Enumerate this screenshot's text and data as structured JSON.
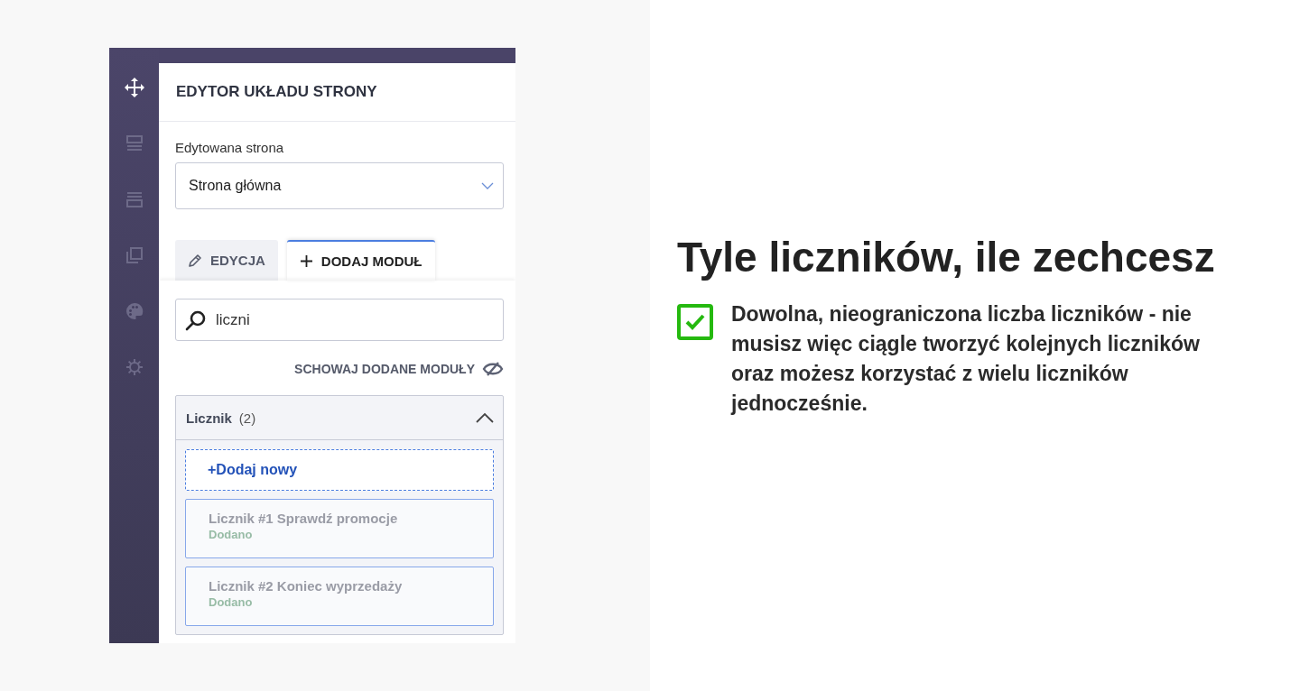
{
  "sidebar": {
    "items": [
      {
        "kind": "move",
        "selected": true
      },
      {
        "kind": "layout-top",
        "selected": false
      },
      {
        "kind": "layout-bottom",
        "selected": false
      },
      {
        "kind": "copy",
        "selected": false
      },
      {
        "kind": "palette",
        "selected": false
      },
      {
        "kind": "settings",
        "selected": false
      }
    ]
  },
  "panel": {
    "title": "EDYTOR UKŁADU STRONY",
    "page_label": "Edytowana strona",
    "page_select": {
      "value": "Strona główna"
    },
    "tabs": [
      {
        "kind": "pencil",
        "label": "EDYCJA",
        "selected": false
      },
      {
        "kind": "plus",
        "label": "DODAJ MODUŁ",
        "selected": true
      }
    ],
    "search": {
      "value": "liczni"
    },
    "hide_added": "SCHOWAJ DODANE MODUŁY",
    "group": {
      "title": "Licznik",
      "count": "(2)",
      "expanded": true,
      "items": [
        {
          "kind": "add",
          "label": "+Dodaj nowy"
        },
        {
          "kind": "module",
          "label": "Licznik #1 Sprawdź promocje",
          "status": "Dodano"
        },
        {
          "kind": "module",
          "label": "Licznik #2 Koniec wyprzedaży",
          "status": "Dodano"
        }
      ]
    }
  },
  "promo": {
    "heading": "Tyle liczników, ile zechcesz",
    "features": [
      {
        "checked": true,
        "text": "Dowolna, nieograniczona liczba liczników - nie musisz więc ciągle tworzyć kolejnych liczników oraz możesz korzystać z wielu liczników jednocześnie."
      }
    ]
  }
}
